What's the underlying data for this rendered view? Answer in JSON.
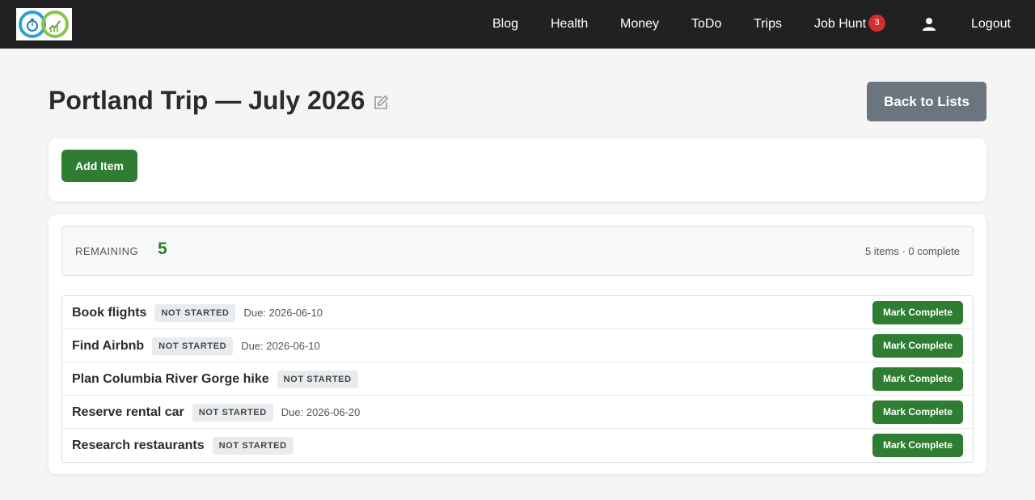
{
  "nav": {
    "logo": "logo-icon",
    "links": [
      {
        "label": "Blog"
      },
      {
        "label": "Health"
      },
      {
        "label": "Money"
      },
      {
        "label": "ToDo"
      },
      {
        "label": "Trips"
      },
      {
        "label": "Job Hunt",
        "badge": "3"
      }
    ],
    "user_icon": "user-icon",
    "logout_label": "Logout"
  },
  "header": {
    "title": "Portland Trip — July 2026",
    "edit_icon": "pencil-edit-icon",
    "back_label": "Back to Lists"
  },
  "actions": {
    "add_label": "Add Item"
  },
  "summary": {
    "remaining_label": "REMAINING",
    "remaining_value": "5",
    "count_text": "5 items · 0 complete"
  },
  "items": [
    {
      "title": "Book flights",
      "status": "NOT STARTED",
      "due": "Due: 2026-06-10",
      "action": "Mark Complete"
    },
    {
      "title": "Find Airbnb",
      "status": "NOT STARTED",
      "due": "Due: 2026-06-10",
      "action": "Mark Complete"
    },
    {
      "title": "Plan Columbia River Gorge hike",
      "status": "NOT STARTED",
      "due": "",
      "action": "Mark Complete"
    },
    {
      "title": "Reserve rental car",
      "status": "NOT STARTED",
      "due": "Due: 2026-06-20",
      "action": "Mark Complete"
    },
    {
      "title": "Research restaurants",
      "status": "NOT STARTED",
      "due": "",
      "action": "Mark Complete"
    }
  ],
  "colors": {
    "navbar": "#212121",
    "primary_green": "#2e7d32",
    "secondary_gray": "#6c757d",
    "badge_red": "#d32f2f"
  }
}
